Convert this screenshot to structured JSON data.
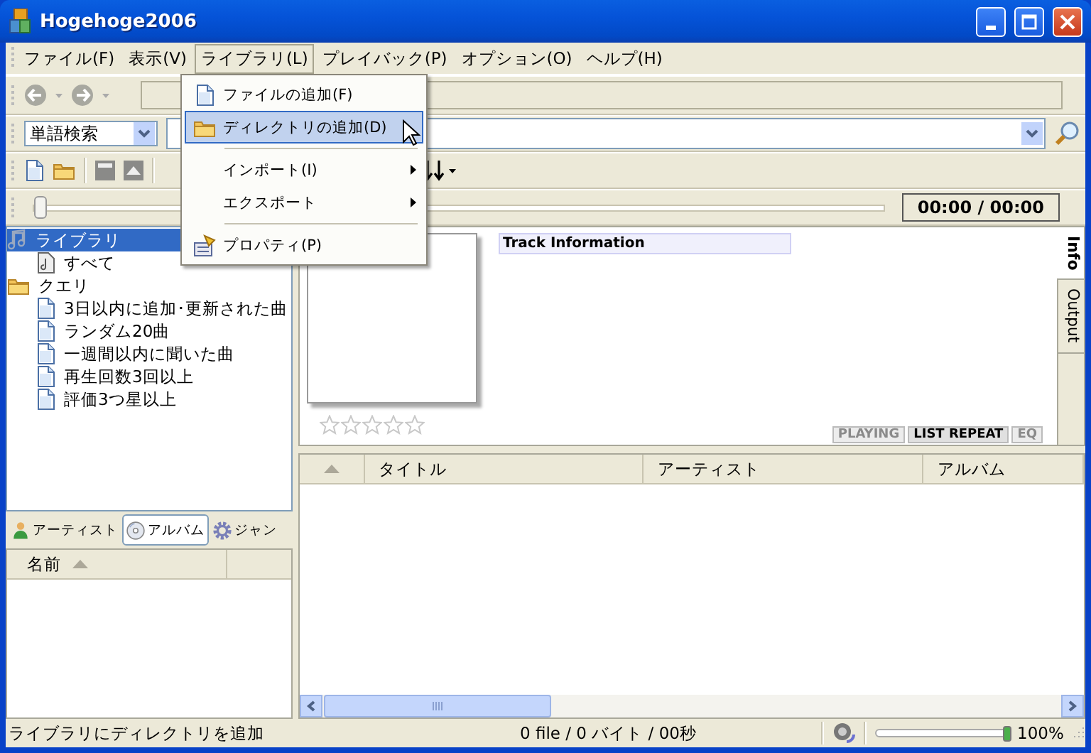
{
  "window": {
    "title": "Hogehoge2006"
  },
  "menu_bar": [
    {
      "label": "ファイル(F)",
      "selected": false
    },
    {
      "label": "表示(V)",
      "selected": false
    },
    {
      "label": "ライブラリ(L)",
      "selected": true
    },
    {
      "label": "プレイバック(P)",
      "selected": false
    },
    {
      "label": "オプション(O)",
      "selected": false
    },
    {
      "label": "ヘルプ(H)",
      "selected": false
    }
  ],
  "open_menu": [
    {
      "kind": "item",
      "label": "ファイルの追加(F)",
      "selected": false,
      "submenu": false
    },
    {
      "kind": "item",
      "label": "ディレクトリの追加(D)",
      "selected": true,
      "submenu": false
    },
    {
      "kind": "separator"
    },
    {
      "kind": "item",
      "label": "インポート(I)",
      "selected": false,
      "submenu": true
    },
    {
      "kind": "item",
      "label": "エクスポート",
      "selected": false,
      "submenu": true
    },
    {
      "kind": "separator"
    },
    {
      "kind": "item",
      "label": "プロパティ(P)",
      "selected": false,
      "submenu": false
    }
  ],
  "search": {
    "mode": "単語検索"
  },
  "seek": {
    "level": 0,
    "time": "00:00 / 00:00"
  },
  "library_tree": [
    {
      "label": "ライブラリ",
      "selected": true,
      "children": [
        {
          "label": "すべて",
          "selected": false
        }
      ]
    },
    {
      "label": "クエリ",
      "selected": false,
      "children": [
        {
          "label": "3日以内に追加･更新された曲",
          "selected": false
        },
        {
          "label": "ランダム20曲",
          "selected": false
        },
        {
          "label": "一週間以内に聞いた曲",
          "selected": false
        },
        {
          "label": "再生回数3回以上",
          "selected": false
        },
        {
          "label": "評価3つ星以上",
          "selected": false
        }
      ]
    }
  ],
  "browser_tabs": [
    {
      "label": "アーティスト",
      "selected": false
    },
    {
      "label": "アルバム",
      "selected": true
    },
    {
      "label": "ジャン",
      "selected": false
    }
  ],
  "browser_columns": [
    "名前"
  ],
  "info": {
    "header": "Track Information",
    "stars": 0,
    "side_tabs": [
      {
        "label": "Info",
        "selected": true
      },
      {
        "label": "Output",
        "selected": false
      }
    ],
    "indicators": [
      {
        "label": "PLAYING",
        "on": false
      },
      {
        "label": "LIST REPEAT",
        "on": true
      },
      {
        "label": "EQ",
        "on": false
      }
    ]
  },
  "track_columns": [
    "タイトル",
    "アーティスト",
    "アルバム"
  ],
  "status_bar": {
    "message": "ライブラリにディレクトリを追加",
    "summary": "0 file / 0 バイト / 00秒",
    "volume": {
      "level": 1,
      "reading": "100%"
    }
  }
}
